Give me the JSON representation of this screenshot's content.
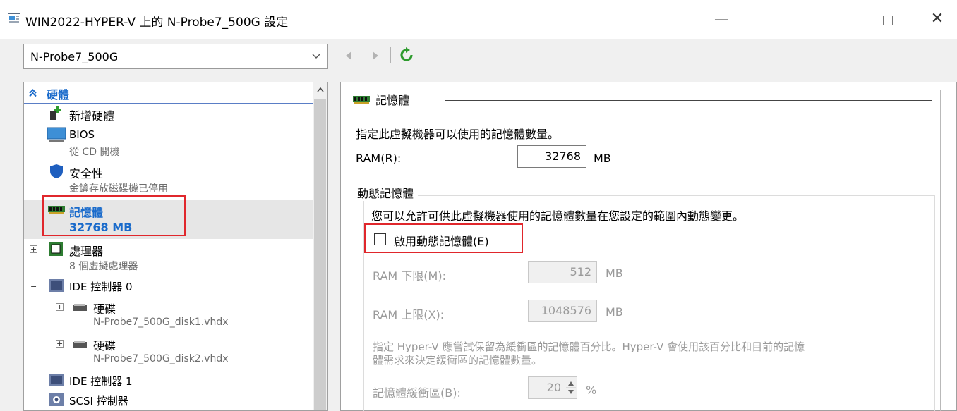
{
  "window": {
    "title": "WIN2022-HYPER-V 上的 N-Probe7_500G 設定",
    "controls": {
      "minimize": "—",
      "close": "✕"
    }
  },
  "vm_selector": {
    "value": "N-Probe7_500G"
  },
  "tree": {
    "header": "硬體",
    "items": [
      {
        "label": "新增硬體"
      },
      {
        "label": "BIOS",
        "sub": "從 CD 開機"
      },
      {
        "label": "安全性",
        "sub": "金鑰存放磁碟機已停用"
      },
      {
        "label": "記憶體",
        "sub": "32768 MB"
      },
      {
        "label": "處理器",
        "sub": "8 個虛擬處理器"
      },
      {
        "label": "IDE 控制器 0"
      },
      {
        "label": "硬碟",
        "sub": "N-Probe7_500G_disk1.vhdx"
      },
      {
        "label": "硬碟",
        "sub": "N-Probe7_500G_disk2.vhdx"
      },
      {
        "label": "IDE 控制器 1"
      },
      {
        "label": "SCSI 控制器"
      }
    ],
    "expander_plus": "+",
    "expander_minus": "−"
  },
  "memory": {
    "section_title": "記憶體",
    "description": "指定此虛擬機器可以使用的記憶體數量。",
    "ram_label": "RAM(R):",
    "ram_value": "32768",
    "unit_mb": "MB",
    "dynamic": {
      "group_title": "動態記憶體",
      "description": "您可以允許可供此虛擬機器使用的記憶體數量在您設定的範圍內動態變更。",
      "checkbox_label": "啟用動態記憶體(E)",
      "checked": false,
      "min_label": "RAM 下限(M):",
      "min_value": "512",
      "max_label": "RAM 上限(X):",
      "max_value": "1048576",
      "buffer_desc_line1": "指定 Hyper-V 應嘗試保留為緩衝區的記憶體百分比。Hyper-V 會使用該百分比和目前的記憶",
      "buffer_desc_line2": "體需求來決定緩衝區的記憶體數量。",
      "buffer_label": "記憶體緩衝區(B):",
      "buffer_value": "20",
      "percent": "%"
    }
  },
  "colors": {
    "accent_blue": "#1a6bcb",
    "highlight_red": "#e0272c",
    "selection_gray": "#e6e6e6"
  }
}
